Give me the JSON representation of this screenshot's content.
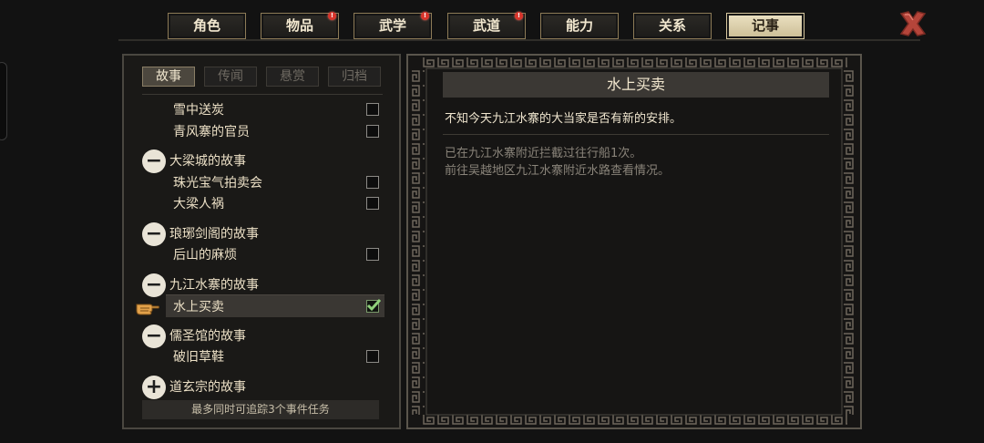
{
  "tabs": [
    {
      "label": "角色",
      "active": false,
      "alert": false
    },
    {
      "label": "物品",
      "active": false,
      "alert": true
    },
    {
      "label": "武学",
      "active": false,
      "alert": true
    },
    {
      "label": "武道",
      "active": false,
      "alert": true
    },
    {
      "label": "能力",
      "active": false,
      "alert": false
    },
    {
      "label": "关系",
      "active": false,
      "alert": false
    },
    {
      "label": "记事",
      "active": true,
      "alert": false
    }
  ],
  "subtabs": [
    {
      "label": "故事",
      "active": true
    },
    {
      "label": "传闻",
      "active": false
    },
    {
      "label": "悬赏",
      "active": false
    },
    {
      "label": "归档",
      "active": false
    }
  ],
  "quest_list": [
    {
      "type": "item",
      "label": "雪中送炭",
      "checked": false
    },
    {
      "type": "item",
      "label": "青风寨的官员",
      "checked": false
    },
    {
      "type": "group",
      "label": "大梁城的故事",
      "expanded": true
    },
    {
      "type": "item",
      "label": "珠光宝气拍卖会",
      "checked": false
    },
    {
      "type": "item",
      "label": "大梁人祸",
      "checked": false
    },
    {
      "type": "group",
      "label": "琅琊剑阁的故事",
      "expanded": true
    },
    {
      "type": "item",
      "label": "后山的麻烦",
      "checked": false
    },
    {
      "type": "group",
      "label": "九江水寨的故事",
      "expanded": true
    },
    {
      "type": "item",
      "label": "水上买卖",
      "checked": true,
      "selected": true
    },
    {
      "type": "group",
      "label": "儒圣馆的故事",
      "expanded": true
    },
    {
      "type": "item",
      "label": "破旧草鞋",
      "checked": false
    },
    {
      "type": "group",
      "label": "道玄宗的故事",
      "expanded": false
    }
  ],
  "footer_note": "最多同时可追踪3个事件任务",
  "detail": {
    "title": "水上买卖",
    "description": "不知今天九江水寨的大当家是否有新的安排。",
    "log": [
      "已在九江水寨附近拦截过往行船1次。",
      "前往吴越地区九江水寨附近水路查看情况。"
    ]
  },
  "icons": {
    "close": "close-x-icon",
    "pointer": "pointing-hand-icon",
    "alert_badge": "!"
  },
  "colors": {
    "accent_gold": "#8d7b57",
    "active_tab_bg": "#ece2c3",
    "alert_red": "#d9342b",
    "close_red": "#c4463a"
  }
}
